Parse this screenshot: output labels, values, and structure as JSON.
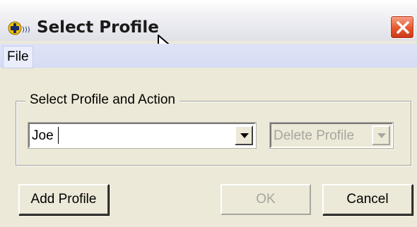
{
  "window": {
    "title": "Select Profile",
    "icon": "app-logo-icon",
    "close_icon": "close-icon"
  },
  "menu": {
    "items": [
      {
        "label": "File"
      }
    ]
  },
  "group": {
    "legend": "Select Profile and Action"
  },
  "profile_combo": {
    "value": "Joe",
    "arrow_icon": "chevron-down-icon"
  },
  "action_combo": {
    "value": "Delete Profile",
    "enabled": false,
    "arrow_icon": "chevron-down-icon"
  },
  "buttons": {
    "add_profile": "Add Profile",
    "ok": "OK",
    "ok_enabled": false,
    "cancel": "Cancel"
  },
  "colors": {
    "close_button": "#e4572e",
    "disabled_text": "#a7a69e",
    "dialog_background": "#ece9d8"
  }
}
